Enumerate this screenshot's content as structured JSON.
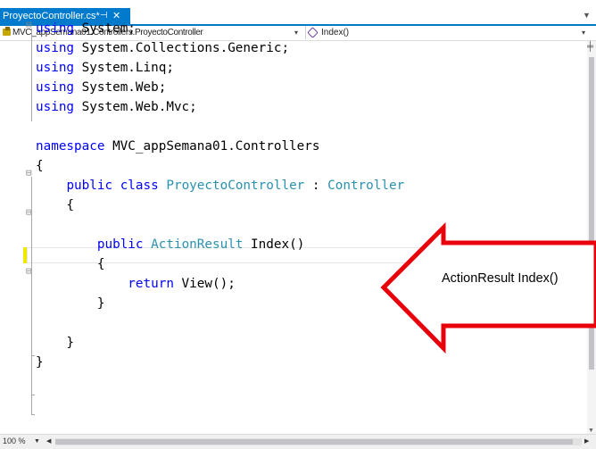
{
  "tab": {
    "title": "ProyectoController.cs*",
    "pin_glyph": "⊣",
    "close_glyph": "✕"
  },
  "navigation": {
    "type_dropdown": "MVC_appSemana01.Controllers.ProyectoController",
    "member_dropdown": "Index()",
    "type_icon": "class-icon",
    "member_icon": "method-icon"
  },
  "editor": {
    "fold_glyph": "⊟",
    "lines": [
      [
        {
          "t": "using",
          "c": "kw"
        },
        {
          "t": " System;",
          "c": "pl"
        }
      ],
      [
        {
          "t": "using",
          "c": "kw"
        },
        {
          "t": " System.Collections.Generic;",
          "c": "pl"
        }
      ],
      [
        {
          "t": "using",
          "c": "kw"
        },
        {
          "t": " System.Linq;",
          "c": "pl"
        }
      ],
      [
        {
          "t": "using",
          "c": "kw"
        },
        {
          "t": " System.Web;",
          "c": "pl"
        }
      ],
      [
        {
          "t": "using",
          "c": "kw"
        },
        {
          "t": " System.Web.Mvc;",
          "c": "pl"
        }
      ],
      [],
      [
        {
          "t": "namespace",
          "c": "kw"
        },
        {
          "t": " MVC_appSemana01.Controllers",
          "c": "pl"
        }
      ],
      [
        {
          "t": "{",
          "c": "pl"
        }
      ],
      [
        {
          "t": "    ",
          "c": "pl"
        },
        {
          "t": "public",
          "c": "kw"
        },
        {
          "t": " ",
          "c": "pl"
        },
        {
          "t": "class",
          "c": "kw"
        },
        {
          "t": " ",
          "c": "pl"
        },
        {
          "t": "ProyectoController",
          "c": "ty"
        },
        {
          "t": " : ",
          "c": "pl"
        },
        {
          "t": "Controller",
          "c": "ty"
        }
      ],
      [
        {
          "t": "    {",
          "c": "pl"
        }
      ],
      [],
      [
        {
          "t": "        ",
          "c": "pl"
        },
        {
          "t": "public",
          "c": "kw"
        },
        {
          "t": " ",
          "c": "pl"
        },
        {
          "t": "ActionResult",
          "c": "ty"
        },
        {
          "t": " Index()",
          "c": "pl"
        }
      ],
      [
        {
          "t": "        {",
          "c": "pl"
        }
      ],
      [
        {
          "t": "            ",
          "c": "pl"
        },
        {
          "t": "return",
          "c": "kw"
        },
        {
          "t": " View();",
          "c": "pl"
        }
      ],
      [
        {
          "t": "        }",
          "c": "pl"
        }
      ],
      [],
      [
        {
          "t": "    }",
          "c": "pl"
        }
      ],
      [
        {
          "t": "}",
          "c": "pl"
        }
      ]
    ]
  },
  "status": {
    "zoom": "100 %"
  },
  "annotation": {
    "text": "ActionResult Index()",
    "arrow_color": "#e8000b"
  },
  "colors": {
    "tab_accent": "#007acc",
    "keyword": "#0000ff",
    "type": "#2b91af",
    "change_marker": "#efe800"
  }
}
